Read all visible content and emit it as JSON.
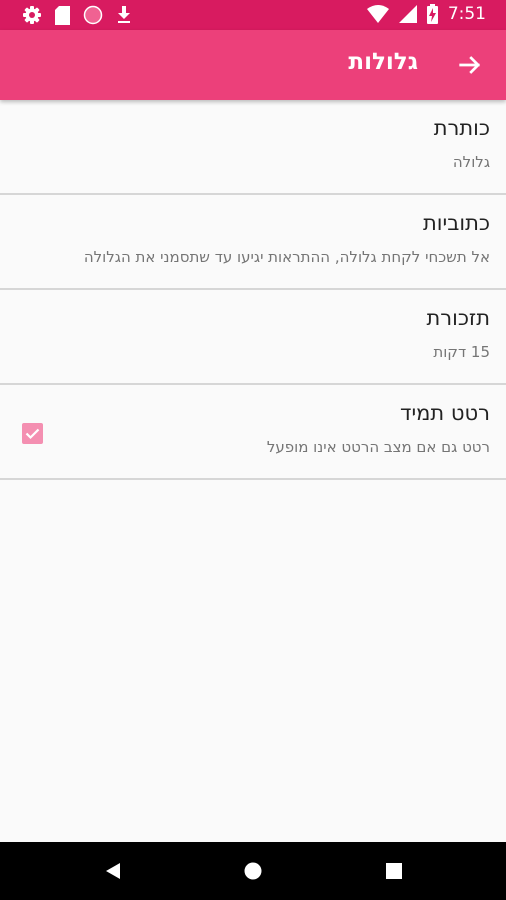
{
  "status_bar": {
    "time": "7:51",
    "left_icons": [
      "gear-icon",
      "sd-card-icon",
      "circle-icon",
      "download-icon"
    ],
    "right_icons": [
      "wifi-icon",
      "signal-icon",
      "battery-charging-icon"
    ]
  },
  "app_bar": {
    "title": "גלולות",
    "back_icon": "arrow-right-icon"
  },
  "preferences": [
    {
      "title": "כותרת",
      "summary": "גלולה"
    },
    {
      "title": "כתוביות",
      "summary": "אל תשכחי לקחת גלולה, ההתראות יגיעו עד שתסמני את הגלולה"
    },
    {
      "title": "תזכורת",
      "summary": "15 דקות"
    },
    {
      "title": "רטט תמיד",
      "summary": "רטט גם אם מצב הרטט אינו מופעל",
      "checked": true
    }
  ],
  "colors": {
    "status_bar": "#d81b60",
    "app_bar": "#ec407a",
    "checkbox": "#f48fb1"
  },
  "nav_bar": {
    "icons": [
      "back-triangle-icon",
      "home-circle-icon",
      "recents-square-icon"
    ]
  }
}
